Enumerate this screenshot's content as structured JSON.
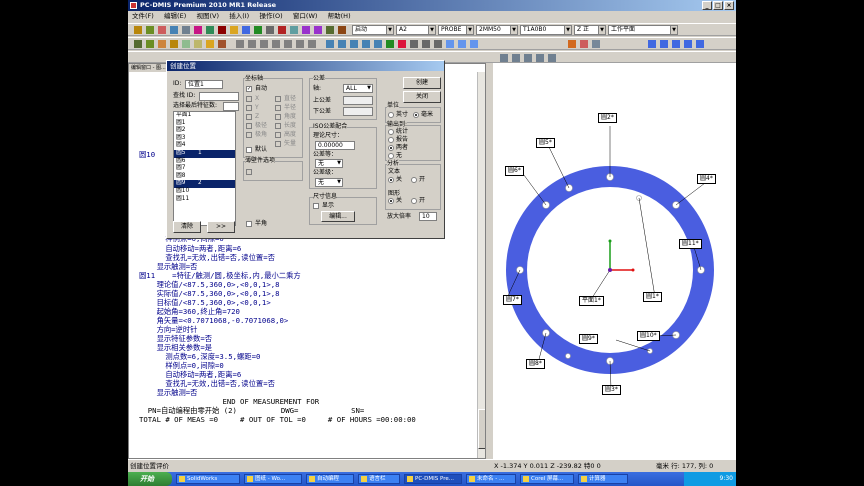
{
  "app": {
    "title": "PC-DMIS Premium 2010 MR1 Release",
    "window_buttons": [
      "_",
      "□",
      "×"
    ],
    "menu": [
      "文件(F)",
      "编辑(E)",
      "视图(V)",
      "插入(I)",
      "操作(O)",
      "窗口(W)",
      "帮助(H)"
    ]
  },
  "toolbar": {
    "mode_combo": "启动",
    "alignment_combo": "A2",
    "probe_combo": "PROBE",
    "probe_tip_combo": "2MM50",
    "tip_combo": "T1A0B0",
    "axis_combo": "Z 正",
    "workplane_combo": "工作平面"
  },
  "editor": {
    "tab_label": "编辑窗口 - 图...",
    "lines": [
      {
        "label": "圆10",
        "text": ""
      },
      {
        "label": "",
        "text": "      样例点=0,间隙=0"
      },
      {
        "label": "",
        "text": "      自动移动=两者,距离=6"
      },
      {
        "label": "",
        "text": "      查找孔=无效,出错=否,读位置=否"
      },
      {
        "label": "",
        "text": "    显示触测=否"
      },
      {
        "label": "圆11",
        "text": "   =特征/触测/圆,极坐标,内,最小二乘方"
      },
      {
        "label": "",
        "text": "    理论值/<87.5,360,0>,<0,0,1>,8"
      },
      {
        "label": "",
        "text": "    实际值/<87.5,360,0>,<0,0,1>,8"
      },
      {
        "label": "",
        "text": "    目标值/<87.5,360,0>,<0,0,1>"
      },
      {
        "label": "",
        "text": "    起始角=360,终止角=720"
      },
      {
        "label": "",
        "text": "    角矢量=<0.7071068,-0.7071068,0>"
      },
      {
        "label": "",
        "text": "    方向=逆时针"
      },
      {
        "label": "",
        "text": "    显示特征参数=否"
      },
      {
        "label": "",
        "text": "    显示相关参数=是"
      },
      {
        "label": "",
        "text": "      测点数=6,深度=3.5,螺距=0"
      },
      {
        "label": "",
        "text": "      样例点=0,间隙=0"
      },
      {
        "label": "",
        "text": "      自动移动=两者,距离=6"
      },
      {
        "label": "",
        "text": "      查找孔=无效,出错=否,读位置=否"
      },
      {
        "label": "",
        "text": "    显示触测=否"
      }
    ],
    "footer_lines": [
      "                   END OF MEASUREMENT FOR",
      "  PN=自动编程由零开始 (2)          DWG=            SN=",
      "TOTAL # OF MEAS =0     # OUT OF TOL =0     # OF HOURS =00:00:00"
    ]
  },
  "dialog": {
    "title": "创建位置",
    "id_label": "ID:",
    "id_value": "位置1",
    "find_label": "查找 ID:",
    "find_value": "",
    "select_last_label": "选择最后特征数:",
    "select_last_value": "",
    "feature_list": [
      {
        "name": "平面1",
        "num": "",
        "selected": false
      },
      {
        "name": "圆1",
        "num": "",
        "selected": false
      },
      {
        "name": "圆2",
        "num": "",
        "selected": false
      },
      {
        "name": "圆3",
        "num": "",
        "selected": false
      },
      {
        "name": "圆4",
        "num": "",
        "selected": false
      },
      {
        "name": "圆5",
        "num": "1",
        "selected": true
      },
      {
        "name": "圆6",
        "num": "",
        "selected": false
      },
      {
        "name": "圆7",
        "num": "",
        "selected": false
      },
      {
        "name": "圆8",
        "num": "",
        "selected": false
      },
      {
        "name": "圆9",
        "num": "2",
        "selected": true
      },
      {
        "name": "圆10",
        "num": "",
        "selected": false
      },
      {
        "name": "圆11",
        "num": "",
        "selected": false
      }
    ],
    "clear_button": "清除",
    "more_button": ">>",
    "axes_group": "坐标轴",
    "auto_label": "自动",
    "axis_left": [
      "X",
      "Y",
      "Z",
      "D",
      "R",
      "A",
      "T",
      "V",
      "L"
    ],
    "axis_left_labels": [
      "",
      "",
      "",
      "",
      "极径",
      "极角",
      "",
      "",
      ""
    ],
    "axis_right_labels": [
      "直径",
      "半径",
      "角度",
      "长度",
      "高度",
      "矢量",
      "深度",
      "形状"
    ],
    "default_label": "默认",
    "thin_part_label": "薄壁件选项",
    "half_angle_label": "半角",
    "tolerance_group": "公差",
    "axis_label": "轴:",
    "axis_value": "ALL",
    "upper_tol_label": "上公差",
    "lower_tol_label": "下公差",
    "iso_group": "ISO公差配合",
    "nominal_size_label": "理论尺寸：",
    "nominal_size_value": "0.00000",
    "tol_class_label": "公差等：",
    "tol_class_value": "无",
    "tol_grade_label": "公差级：",
    "tol_grade_value": "无",
    "dim_info_group": "尺寸信息",
    "show_label": "显示",
    "edit_button": "编辑...",
    "create_button": "创建",
    "close_button": "关闭",
    "units_group": "单位",
    "inch_label": "英寸",
    "mm_label": "毫米",
    "output_group": "输出到:",
    "output_options": [
      "统计",
      "报告",
      "两者",
      "无"
    ],
    "analysis_group": "分析",
    "text_label": "文本",
    "graph_label": "图形",
    "off_label": "关",
    "on_label": "开",
    "magnify_label": "放大倍率",
    "magnify_value": "10"
  },
  "graphics": {
    "ring_color": "#4a5ee0",
    "labels": [
      {
        "text": "圆2*"
      },
      {
        "text": "圆5*"
      },
      {
        "text": "圆6*"
      },
      {
        "text": "圆4*"
      },
      {
        "text": "圆11*"
      },
      {
        "text": "平面1*"
      },
      {
        "text": "圆7*"
      },
      {
        "text": "圆1*"
      },
      {
        "text": "圆9*"
      },
      {
        "text": "圆10*"
      },
      {
        "text": "圆8*"
      },
      {
        "text": "圆3*"
      }
    ]
  },
  "status": {
    "left": "创建位置评价",
    "coords": "X -1.374  Y 0.011   Z -239.82 特0  0",
    "units": "毫米 行: 177, 列:  0"
  },
  "taskbar": {
    "start": "开始",
    "tasks": [
      "SolidWorks",
      "图纸 - Wo...",
      "自动编程",
      "语言栏",
      "PC-DMIS Pre...",
      "未命名 - ...",
      "Corel 屏幕...",
      "计算器"
    ],
    "clock": "9:30"
  }
}
